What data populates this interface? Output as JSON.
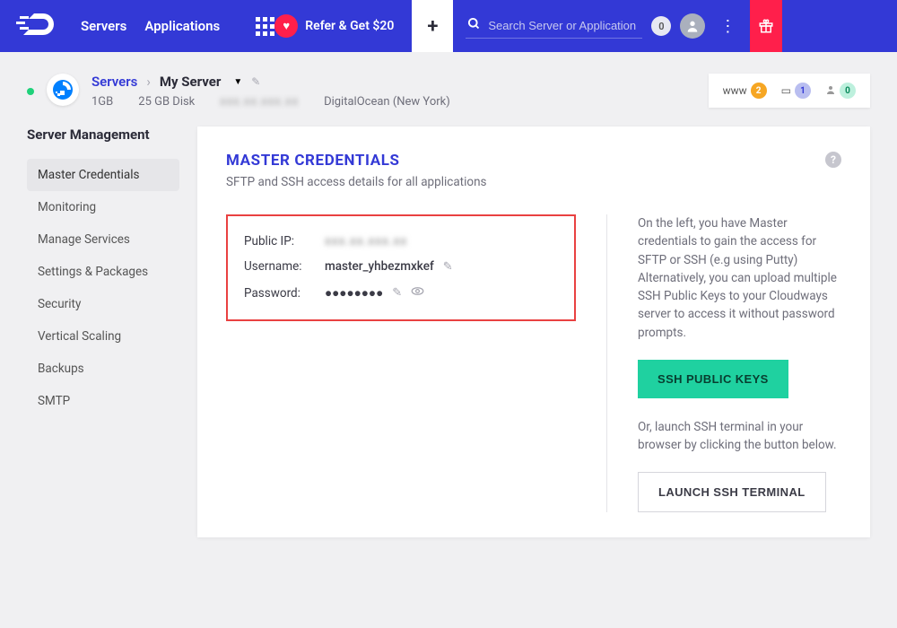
{
  "top": {
    "nav": [
      "Servers",
      "Applications"
    ],
    "refer": "Refer & Get $20",
    "search_placeholder": "Search Server or Application",
    "search_count": "0"
  },
  "breadcrumb": {
    "root": "Servers",
    "current": "My Server",
    "meta_ram": "1GB",
    "meta_disk": "25 GB Disk",
    "meta_provider": "DigitalOcean (New York)"
  },
  "status": {
    "www": "www",
    "www_n": "2",
    "apps_n": "1",
    "users_n": "0"
  },
  "sidenav": {
    "title": "Server Management",
    "items": [
      "Master Credentials",
      "Monitoring",
      "Manage Services",
      "Settings & Packages",
      "Security",
      "Vertical Scaling",
      "Backups",
      "SMTP"
    ],
    "active": 0
  },
  "panel": {
    "title": "MASTER CREDENTIALS",
    "subtitle": "SFTP and SSH access details for all applications",
    "cred_ip_label": "Public IP:",
    "cred_ip_value": "xxx.xx.xxx.xx",
    "cred_user_label": "Username:",
    "cred_user_value": "master_yhbezmxkef",
    "cred_pass_label": "Password:",
    "cred_pass_value": "●●●●●●●●",
    "right_p1": "On the left, you have Master credentials to gain the access for SFTP or SSH (e.g using Putty) Alternatively, you can upload multiple SSH Public Keys to your Cloudways server to access it without password prompts.",
    "btn_ssh": "SSH PUBLIC KEYS",
    "right_p2": "Or, launch SSH terminal in your browser by clicking the button below.",
    "btn_launch": "LAUNCH SSH TERMINAL"
  }
}
